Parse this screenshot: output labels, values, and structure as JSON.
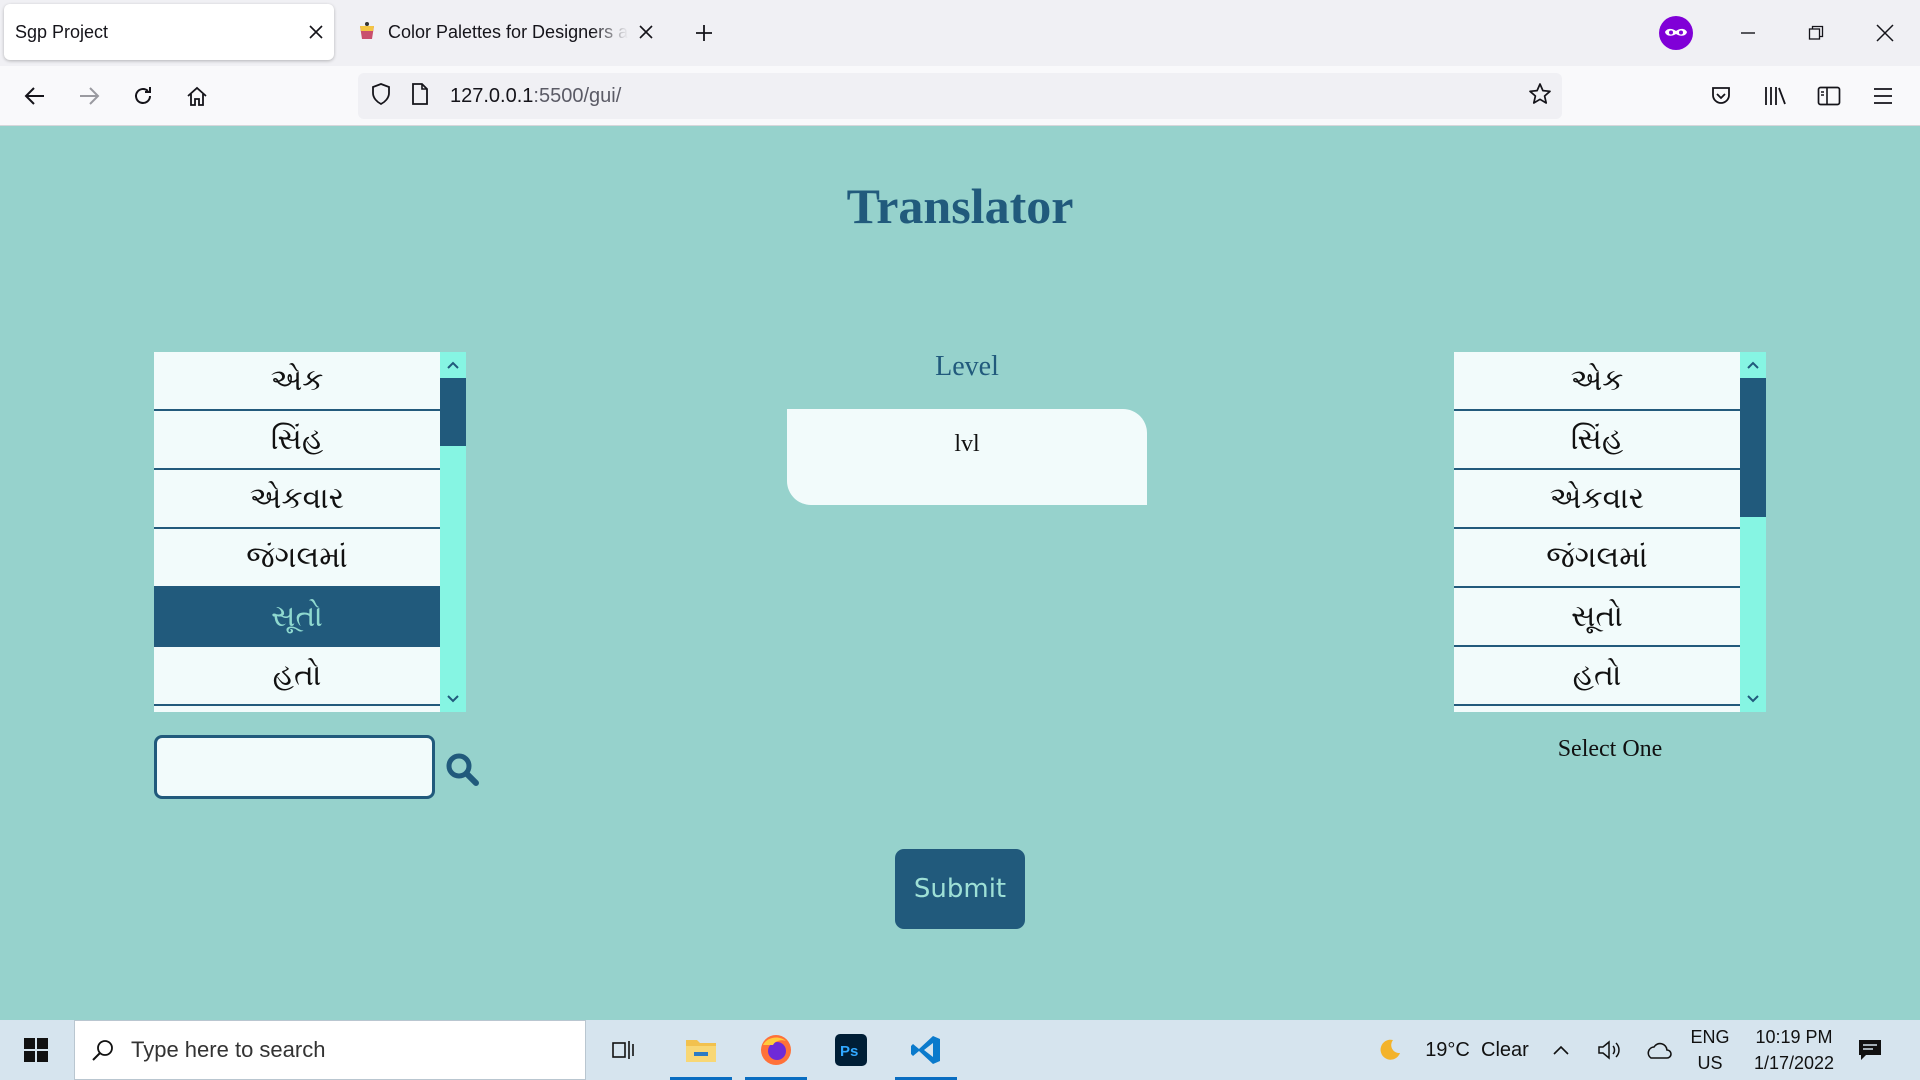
{
  "browser": {
    "tabs": [
      {
        "title": "Sgp Project",
        "active": true
      },
      {
        "title": "Color Palettes for Designers and Artists",
        "active": false
      }
    ],
    "url_host": "127.0.0.1",
    "url_path": ":5500/gui/"
  },
  "page": {
    "title": "Translator",
    "left_list": {
      "items": [
        "એક",
        "સિંહ",
        "એકવાર",
        "જંગલમાં",
        "સૂતો",
        "હતો"
      ],
      "selected_index": 4,
      "scroll_thumb_fraction": 0.22
    },
    "right_list": {
      "items": [
        "એક",
        "સિંહ",
        "એકવાર",
        "જંગલમાં",
        "સૂતો",
        "હતો"
      ],
      "selected_index": -1,
      "scroll_thumb_fraction": 0.45
    },
    "search": {
      "value": "",
      "placeholder": ""
    },
    "level": {
      "label": "Level",
      "value": "lvl"
    },
    "right_caption": "Select One",
    "submit_label": "Submit"
  },
  "taskbar": {
    "search_placeholder": "Type here to search",
    "weather": {
      "temp": "19°C",
      "condition": "Clear"
    },
    "lang": {
      "line1": "ENG",
      "line2": "US"
    },
    "clock": {
      "time": "10:19 PM",
      "date": "1/17/2022"
    }
  },
  "colors": {
    "page_bg": "#96d2cc",
    "accent": "#215a7c",
    "list_bg": "#f2fbfb",
    "scroll_track": "#86f5e3"
  }
}
